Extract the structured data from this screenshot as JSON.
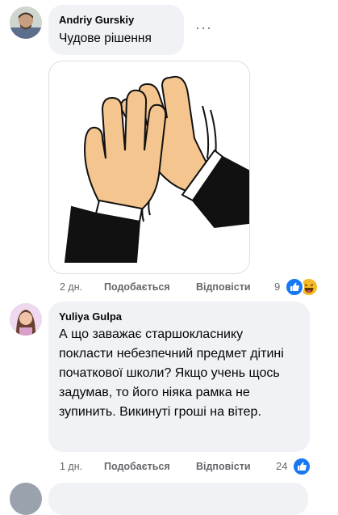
{
  "comments": [
    {
      "author": "Andriy Gurskiy",
      "text": "Чудове рішення",
      "more_label": "···",
      "sticker_icon": "clapping-hands-icon",
      "time": "2 дн.",
      "like_label": "Подобається",
      "reply_label": "Відповісти",
      "reaction_count": "9",
      "reactions": [
        "like-icon",
        "haha-icon"
      ]
    },
    {
      "author": "Yuliya Gulpa",
      "text": "А що заважає старшокласнику покласти небезпечний предмет дітині початкової школи? Якщо учень щось задумав, то його ніяка рамка не зупинить. Викинуті гроші на вітер.",
      "time": "1 дн.",
      "like_label": "Подобається",
      "reply_label": "Відповісти",
      "reaction_count": "24",
      "reactions": [
        "like-icon"
      ]
    }
  ],
  "colors": {
    "bubble": "#f0f2f5",
    "meta_text": "#65676b",
    "like_blue": "#1877f2",
    "haha_yellow": "#f7b928"
  }
}
